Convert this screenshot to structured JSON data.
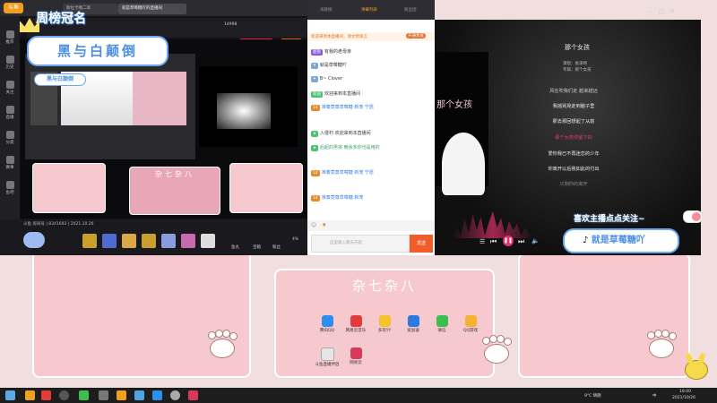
{
  "banners": {
    "ranking": "周榜冠名",
    "title": "黑与白颠倒",
    "title_small": "黑与白颠倒",
    "follow_prompt": "喜欢主播点点关注~",
    "song_banner": "就是草莓糖吖"
  },
  "browser": {
    "logo": "斗鱼",
    "tabs": [
      {
        "label": "斯拉卡啪二郎"
      },
      {
        "label": "就是草莓糖吖的直播间"
      }
    ],
    "task_label": "新人任务:火箭",
    "online_count": "14998",
    "room_info": "斗鱼 房间号 | 8341693 | 2021.10.26",
    "sidebar_items": [
      {
        "label": "推荐"
      },
      {
        "label": "历史"
      },
      {
        "label": "关注"
      },
      {
        "label": "直播"
      },
      {
        "label": "分类"
      },
      {
        "label": "赛事"
      },
      {
        "label": "鱼吧"
      }
    ],
    "bottom_actions": [
      "鱼丸",
      "宝箱",
      "粉丝",
      "4%"
    ]
  },
  "chat": {
    "tabs": [
      "贡献榜",
      "弹幕列表",
      "粉丝团"
    ],
    "top_notice": "欢迎来到本直播间，请文明发言",
    "join_button": "开通贵族",
    "messages": [
      {
        "badge": "超管",
        "user": "",
        "text": "有我的老母亲"
      },
      {
        "badge": "",
        "user": "",
        "text": "就是草莓糖吖"
      },
      {
        "badge": "",
        "user": "",
        "text": "B~ Clover"
      },
      {
        "badge": "欢迎",
        "user": "",
        "text": "欢迎来到本直播间"
      },
      {
        "badge": "14",
        "user": "",
        "text": "准奏竟尊草莓糖 新宠 宁愿"
      },
      {
        "badge": "",
        "user": "",
        "text": "入侵村 欢迎来到本直播间"
      },
      {
        "badge": "",
        "user": "",
        "text": "后起的男孩 晚余多你也是用的"
      },
      {
        "badge": "14",
        "user": "",
        "text": "准奏竟尊草莓糖 新宠 宁愿"
      },
      {
        "badge": "14",
        "user": "",
        "text": "准奏竟尊草莓糖 新宠"
      }
    ],
    "input_placeholder": "这里输入聊天内容",
    "send_label": "发送"
  },
  "player": {
    "song_title": "那个女孩",
    "singer_line": "演唱：张泽熙",
    "album_line": "专辑：那个女孩",
    "cover_text": "那个女孩",
    "lyrics": [
      "风在吹我们走 越来越远",
      "我摇晃晃走到脑子里",
      "那去那回想起了从前",
      "那个女孩你留下的",
      "爱你我已不再迷恋的少年",
      "你离开以后我如此的付出",
      "只剩你的离开"
    ],
    "current_lyric_index": 3
  },
  "desktop": {
    "folder_title": "杂七杂八",
    "folder_title_small": "杂七杂八",
    "icons": [
      {
        "label": "腾讯QQ",
        "color": "#2c8ef0",
        "icon": "qq-icon"
      },
      {
        "label": "网易云音乐",
        "color": "#e33b3b",
        "icon": "netease-music-icon"
      },
      {
        "label": "多玩YY",
        "color": "#f4c22b",
        "icon": "yy-icon"
      },
      {
        "label": "爱加速",
        "color": "#2b7be0",
        "icon": "accelerator-icon"
      },
      {
        "label": "微信",
        "color": "#3cbf50",
        "icon": "wechat-icon"
      },
      {
        "label": "QQ游戏",
        "color": "#f4b233",
        "icon": "qq-game-icon"
      },
      {
        "label": "斗鱼直播伴侣",
        "color": "#e6e6e6",
        "icon": "document-icon"
      },
      {
        "label": "网易云",
        "color": "#d63a5b",
        "icon": "app-icon"
      }
    ]
  },
  "taskbar": {
    "weather": "9°C 晴朗",
    "time": "18:00",
    "date": "2021/10/26",
    "lang": "中"
  }
}
